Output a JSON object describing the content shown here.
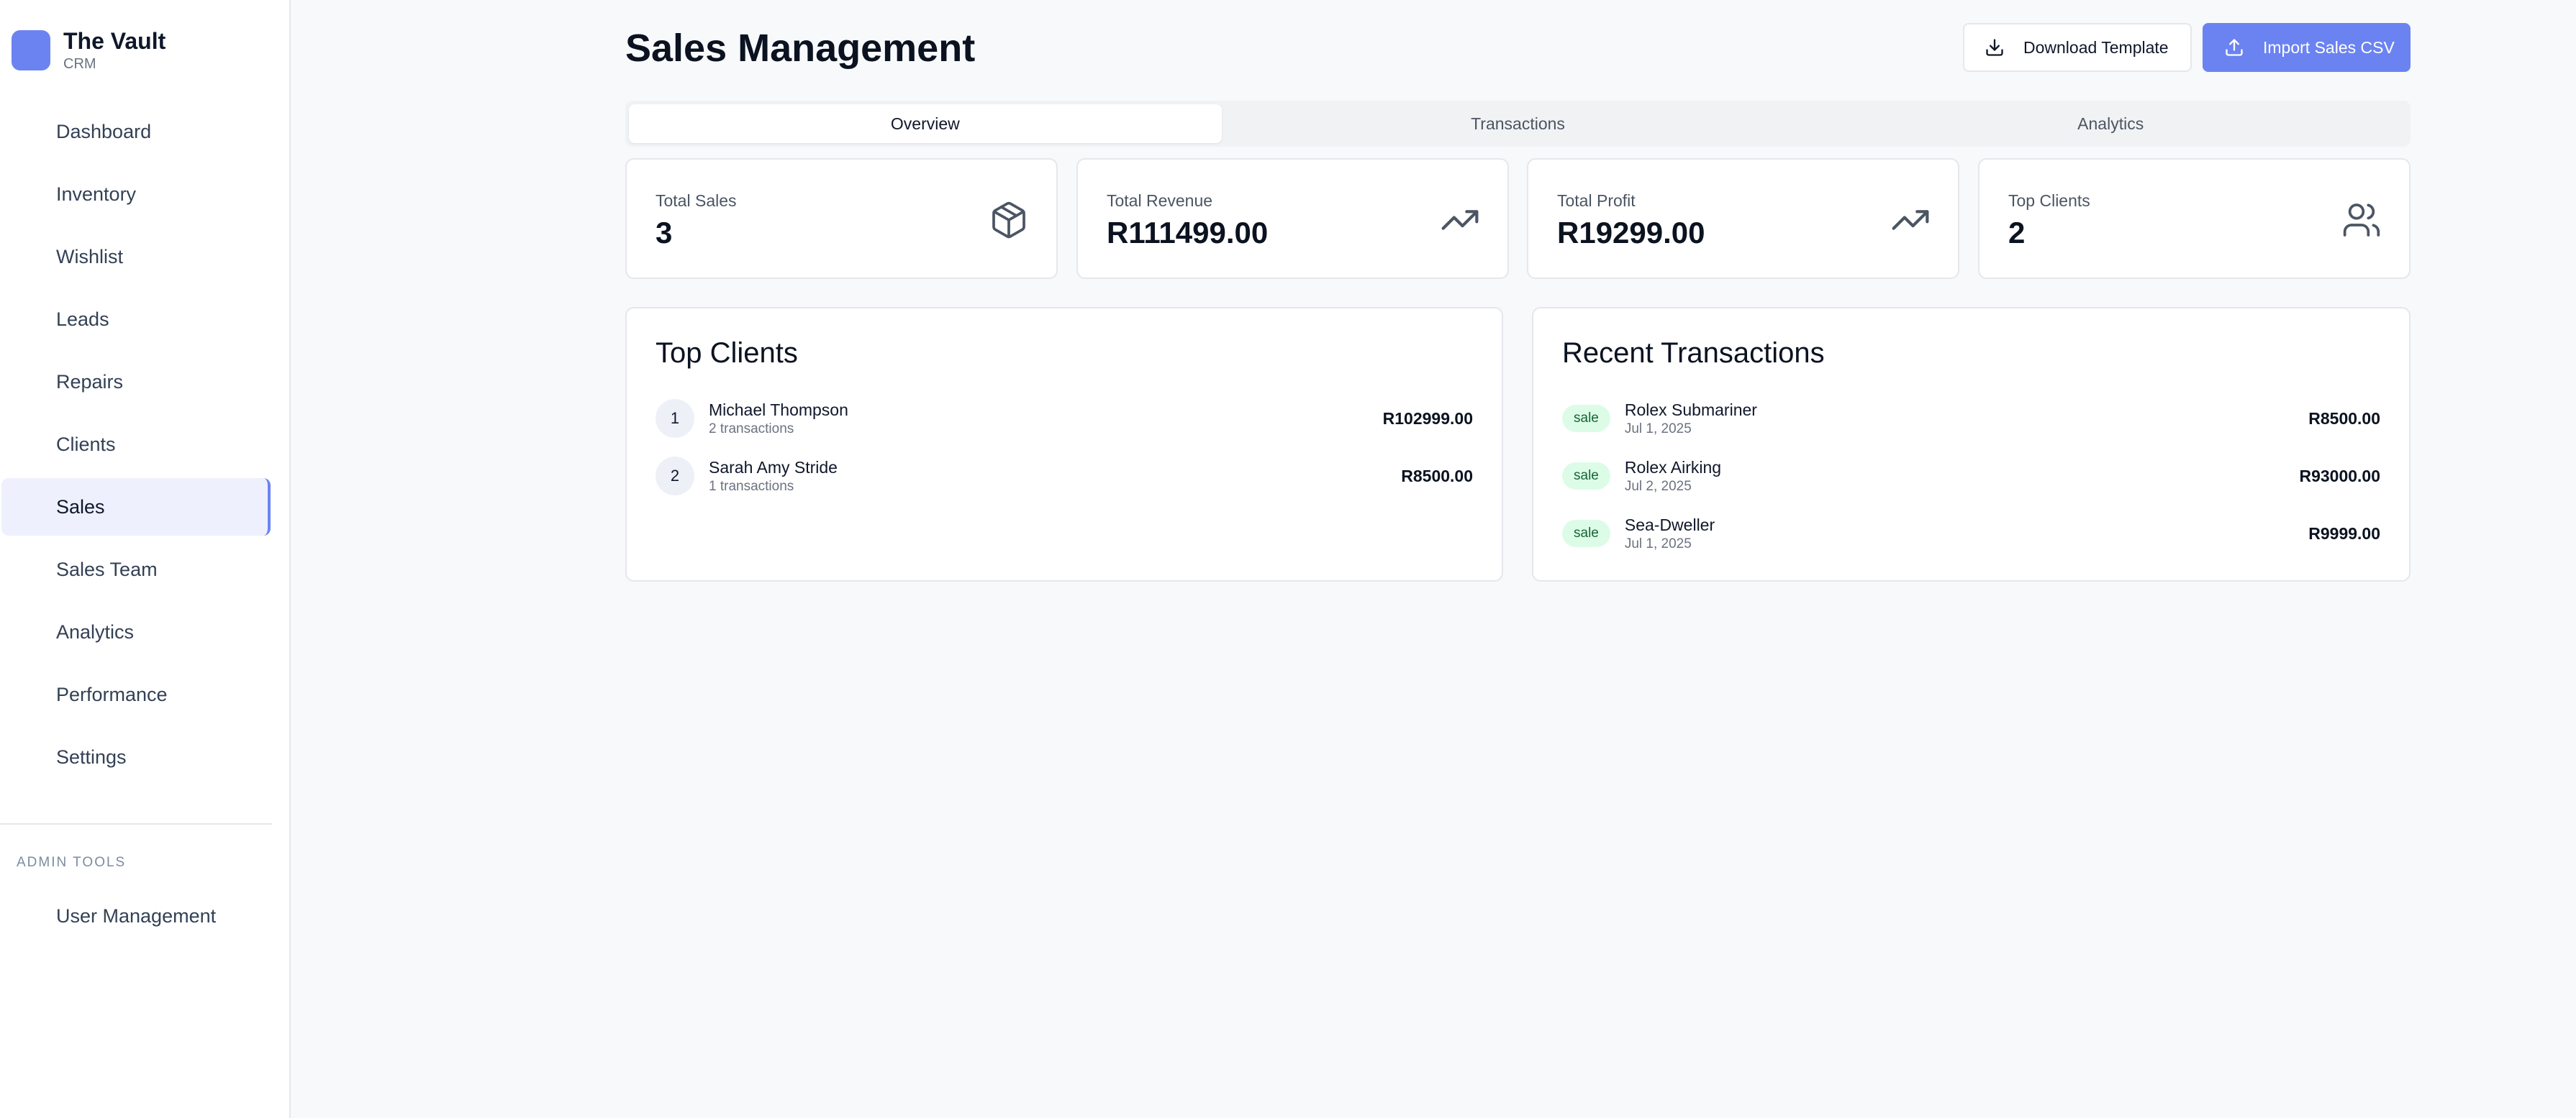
{
  "brand": {
    "name": "The Vault",
    "subtitle": "CRM"
  },
  "sidebar": {
    "items": [
      {
        "label": "Dashboard"
      },
      {
        "label": "Inventory"
      },
      {
        "label": "Wishlist"
      },
      {
        "label": "Leads"
      },
      {
        "label": "Repairs"
      },
      {
        "label": "Clients"
      },
      {
        "label": "Sales",
        "active": true
      },
      {
        "label": "Sales Team"
      },
      {
        "label": "Analytics"
      },
      {
        "label": "Performance"
      },
      {
        "label": "Settings"
      }
    ],
    "admin_label": "ADMIN TOOLS",
    "admin_items": [
      {
        "label": "User Management"
      }
    ]
  },
  "header": {
    "title": "Sales Management",
    "download_label": "Download Template",
    "import_label": "Import Sales CSV"
  },
  "tabs": [
    {
      "label": "Overview",
      "active": true
    },
    {
      "label": "Transactions"
    },
    {
      "label": "Analytics"
    }
  ],
  "stats": [
    {
      "label": "Total Sales",
      "value": "3",
      "icon": "package-icon"
    },
    {
      "label": "Total Revenue",
      "value": "R111499.00",
      "icon": "trending-up-icon"
    },
    {
      "label": "Total Profit",
      "value": "R19299.00",
      "icon": "trending-up-icon"
    },
    {
      "label": "Top Clients",
      "value": "2",
      "icon": "users-icon"
    }
  ],
  "top_clients": {
    "title": "Top Clients",
    "rows": [
      {
        "rank": "1",
        "name": "Michael Thompson",
        "sub": "2 transactions",
        "amount": "R102999.00"
      },
      {
        "rank": "2",
        "name": "Sarah Amy Stride",
        "sub": "1 transactions",
        "amount": "R8500.00"
      }
    ]
  },
  "recent_transactions": {
    "title": "Recent Transactions",
    "rows": [
      {
        "badge": "sale",
        "name": "Rolex Submariner",
        "date": "Jul 1, 2025",
        "amount": "R8500.00"
      },
      {
        "badge": "sale",
        "name": "Rolex Airking",
        "date": "Jul 2, 2025",
        "amount": "R93000.00"
      },
      {
        "badge": "sale",
        "name": "Sea-Dweller",
        "date": "Jul 1, 2025",
        "amount": "R9999.00"
      }
    ]
  },
  "colors": {
    "accent": "#6b83f1",
    "sale_badge_bg": "#dcfce7",
    "sale_badge_text": "#166534"
  }
}
